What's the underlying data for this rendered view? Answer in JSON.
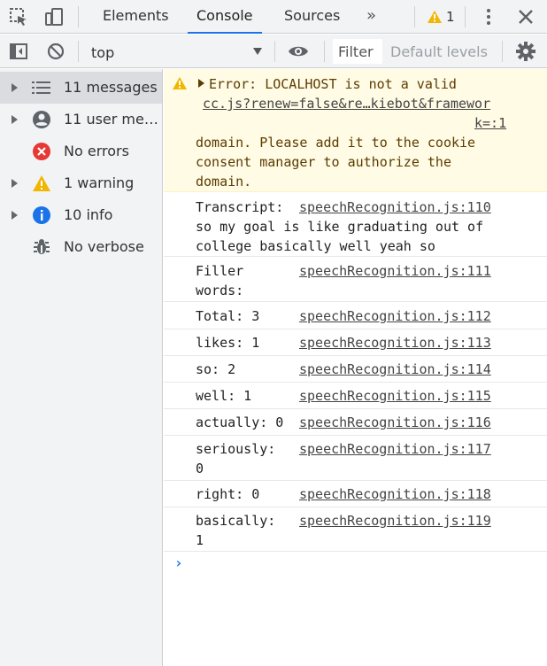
{
  "tabs": {
    "elements": "Elements",
    "console": "Console",
    "sources": "Sources",
    "more": "»",
    "warning_count": "1"
  },
  "toolbar": {
    "context": "top",
    "filter_placeholder": "Filter",
    "levels": "Default levels"
  },
  "sidebar": {
    "items": [
      {
        "label": "11 messages"
      },
      {
        "label": "11 user mes…"
      },
      {
        "label": "No errors"
      },
      {
        "label": "1 warning"
      },
      {
        "label": "10 info"
      },
      {
        "label": "No verbose"
      }
    ]
  },
  "console": {
    "warning": {
      "prefix": "Error: LOCALHOST is not a valid",
      "source_line1": "cc.js?renew=false&re…kiebot&framewor",
      "source_line2": "k=:1",
      "body": "domain. Please add it to the cookie\nconsent manager to authorize the\ndomain."
    },
    "messages": [
      {
        "text": "Transcript:",
        "source": "speechRecognition.js:110",
        "extra": "so my goal is like graduating out of\ncollege basically well yeah so"
      },
      {
        "text": "Filler\nwords:",
        "source": "speechRecognition.js:111"
      },
      {
        "text": "Total: 3",
        "source": "speechRecognition.js:112"
      },
      {
        "text": "likes: 1",
        "source": "speechRecognition.js:113"
      },
      {
        "text": "so: 2",
        "source": "speechRecognition.js:114"
      },
      {
        "text": "well: 1",
        "source": "speechRecognition.js:115"
      },
      {
        "text": "actually: 0",
        "source": "speechRecognition.js:116"
      },
      {
        "text": "seriously:\n0",
        "source": "speechRecognition.js:117"
      },
      {
        "text": "right: 0",
        "source": "speechRecognition.js:118"
      },
      {
        "text": "basically:\n1",
        "source": "speechRecognition.js:119"
      }
    ],
    "prompt": "›"
  },
  "colors": {
    "accent": "#1a73e8",
    "warning_bg": "#fffbe5",
    "warning_icon": "#f2b600",
    "error_icon": "#e53935",
    "info_icon": "#1a73e8"
  }
}
